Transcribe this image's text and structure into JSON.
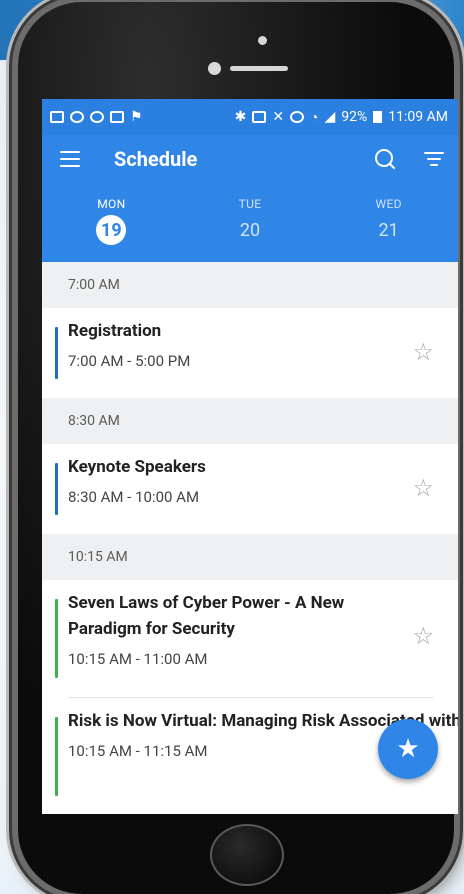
{
  "status_bar": {
    "left_icons": [
      "mail-icon",
      "cloud-icon",
      "upload-icon",
      "image-icon",
      "flag-icon"
    ],
    "right_icons": [
      "bluetooth-icon",
      "nfc-icon",
      "mute-icon",
      "alarm-icon",
      "wifi-icon",
      "signal-icon"
    ],
    "battery": "92%",
    "time": "11:09 AM"
  },
  "app_bar": {
    "title": "Schedule"
  },
  "days": [
    {
      "name": "MON",
      "number": "19",
      "active": true
    },
    {
      "name": "TUE",
      "number": "20",
      "active": false
    },
    {
      "name": "WED",
      "number": "21",
      "active": false
    }
  ],
  "schedule": [
    {
      "header": "7:00 AM",
      "sessions": [
        {
          "title": "Registration",
          "time": "7:00 AM - 5:00 PM",
          "color": "#1e6fc8"
        }
      ]
    },
    {
      "header": "8:30 AM",
      "sessions": [
        {
          "title": "Keynote Speakers",
          "time": "8:30 AM - 10:00 AM",
          "color": "#1e6fc8"
        }
      ]
    },
    {
      "header": "10:15 AM",
      "sessions": [
        {
          "title": "Seven Laws of Cyber Power - A New Paradigm for Security",
          "time": "10:15 AM - 11:00 AM",
          "color": "#3bb34a"
        },
        {
          "title": "Risk is Now Virtual: Managing Risk Associated with Third Party Services",
          "time": "10:15 AM - 11:15 AM",
          "color": "#3bb34a"
        }
      ]
    }
  ],
  "colors": {
    "primary": "#2f86e6",
    "status_bar": "#2b7fde",
    "header_bg": "#eef0f2"
  }
}
